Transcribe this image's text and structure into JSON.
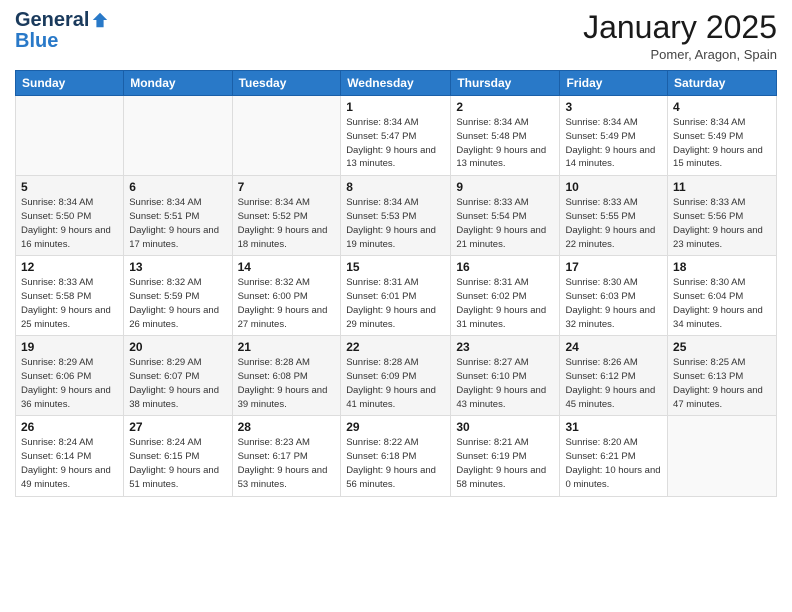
{
  "logo": {
    "general": "General",
    "blue": "Blue"
  },
  "header": {
    "month": "January 2025",
    "location": "Pomer, Aragon, Spain"
  },
  "weekdays": [
    "Sunday",
    "Monday",
    "Tuesday",
    "Wednesday",
    "Thursday",
    "Friday",
    "Saturday"
  ],
  "weeks": [
    [
      {
        "day": "",
        "info": ""
      },
      {
        "day": "",
        "info": ""
      },
      {
        "day": "",
        "info": ""
      },
      {
        "day": "1",
        "info": "Sunrise: 8:34 AM\nSunset: 5:47 PM\nDaylight: 9 hours\nand 13 minutes."
      },
      {
        "day": "2",
        "info": "Sunrise: 8:34 AM\nSunset: 5:48 PM\nDaylight: 9 hours\nand 13 minutes."
      },
      {
        "day": "3",
        "info": "Sunrise: 8:34 AM\nSunset: 5:49 PM\nDaylight: 9 hours\nand 14 minutes."
      },
      {
        "day": "4",
        "info": "Sunrise: 8:34 AM\nSunset: 5:49 PM\nDaylight: 9 hours\nand 15 minutes."
      }
    ],
    [
      {
        "day": "5",
        "info": "Sunrise: 8:34 AM\nSunset: 5:50 PM\nDaylight: 9 hours\nand 16 minutes."
      },
      {
        "day": "6",
        "info": "Sunrise: 8:34 AM\nSunset: 5:51 PM\nDaylight: 9 hours\nand 17 minutes."
      },
      {
        "day": "7",
        "info": "Sunrise: 8:34 AM\nSunset: 5:52 PM\nDaylight: 9 hours\nand 18 minutes."
      },
      {
        "day": "8",
        "info": "Sunrise: 8:34 AM\nSunset: 5:53 PM\nDaylight: 9 hours\nand 19 minutes."
      },
      {
        "day": "9",
        "info": "Sunrise: 8:33 AM\nSunset: 5:54 PM\nDaylight: 9 hours\nand 21 minutes."
      },
      {
        "day": "10",
        "info": "Sunrise: 8:33 AM\nSunset: 5:55 PM\nDaylight: 9 hours\nand 22 minutes."
      },
      {
        "day": "11",
        "info": "Sunrise: 8:33 AM\nSunset: 5:56 PM\nDaylight: 9 hours\nand 23 minutes."
      }
    ],
    [
      {
        "day": "12",
        "info": "Sunrise: 8:33 AM\nSunset: 5:58 PM\nDaylight: 9 hours\nand 25 minutes."
      },
      {
        "day": "13",
        "info": "Sunrise: 8:32 AM\nSunset: 5:59 PM\nDaylight: 9 hours\nand 26 minutes."
      },
      {
        "day": "14",
        "info": "Sunrise: 8:32 AM\nSunset: 6:00 PM\nDaylight: 9 hours\nand 27 minutes."
      },
      {
        "day": "15",
        "info": "Sunrise: 8:31 AM\nSunset: 6:01 PM\nDaylight: 9 hours\nand 29 minutes."
      },
      {
        "day": "16",
        "info": "Sunrise: 8:31 AM\nSunset: 6:02 PM\nDaylight: 9 hours\nand 31 minutes."
      },
      {
        "day": "17",
        "info": "Sunrise: 8:30 AM\nSunset: 6:03 PM\nDaylight: 9 hours\nand 32 minutes."
      },
      {
        "day": "18",
        "info": "Sunrise: 8:30 AM\nSunset: 6:04 PM\nDaylight: 9 hours\nand 34 minutes."
      }
    ],
    [
      {
        "day": "19",
        "info": "Sunrise: 8:29 AM\nSunset: 6:06 PM\nDaylight: 9 hours\nand 36 minutes."
      },
      {
        "day": "20",
        "info": "Sunrise: 8:29 AM\nSunset: 6:07 PM\nDaylight: 9 hours\nand 38 minutes."
      },
      {
        "day": "21",
        "info": "Sunrise: 8:28 AM\nSunset: 6:08 PM\nDaylight: 9 hours\nand 39 minutes."
      },
      {
        "day": "22",
        "info": "Sunrise: 8:28 AM\nSunset: 6:09 PM\nDaylight: 9 hours\nand 41 minutes."
      },
      {
        "day": "23",
        "info": "Sunrise: 8:27 AM\nSunset: 6:10 PM\nDaylight: 9 hours\nand 43 minutes."
      },
      {
        "day": "24",
        "info": "Sunrise: 8:26 AM\nSunset: 6:12 PM\nDaylight: 9 hours\nand 45 minutes."
      },
      {
        "day": "25",
        "info": "Sunrise: 8:25 AM\nSunset: 6:13 PM\nDaylight: 9 hours\nand 47 minutes."
      }
    ],
    [
      {
        "day": "26",
        "info": "Sunrise: 8:24 AM\nSunset: 6:14 PM\nDaylight: 9 hours\nand 49 minutes."
      },
      {
        "day": "27",
        "info": "Sunrise: 8:24 AM\nSunset: 6:15 PM\nDaylight: 9 hours\nand 51 minutes."
      },
      {
        "day": "28",
        "info": "Sunrise: 8:23 AM\nSunset: 6:17 PM\nDaylight: 9 hours\nand 53 minutes."
      },
      {
        "day": "29",
        "info": "Sunrise: 8:22 AM\nSunset: 6:18 PM\nDaylight: 9 hours\nand 56 minutes."
      },
      {
        "day": "30",
        "info": "Sunrise: 8:21 AM\nSunset: 6:19 PM\nDaylight: 9 hours\nand 58 minutes."
      },
      {
        "day": "31",
        "info": "Sunrise: 8:20 AM\nSunset: 6:21 PM\nDaylight: 10 hours\nand 0 minutes."
      },
      {
        "day": "",
        "info": ""
      }
    ]
  ]
}
